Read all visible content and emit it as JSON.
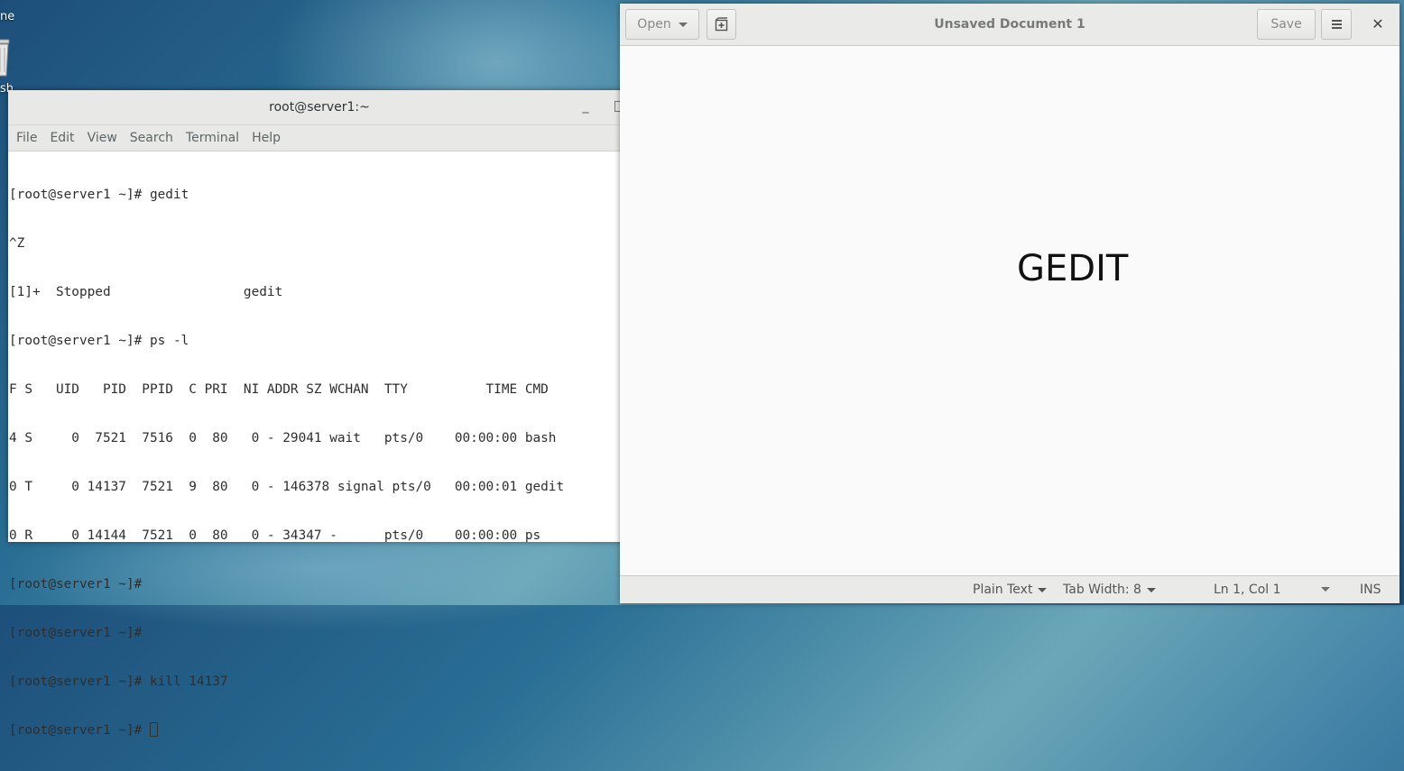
{
  "desktop": {
    "icon1_label": "ne",
    "icon2_label": "sh"
  },
  "terminal": {
    "title": "root@server1:~",
    "menu": [
      "File",
      "Edit",
      "View",
      "Search",
      "Terminal",
      "Help"
    ],
    "lines": [
      "[root@server1 ~]# gedit",
      "^Z",
      "[1]+  Stopped                 gedit",
      "[root@server1 ~]# ps -l",
      "F S   UID   PID  PPID  C PRI  NI ADDR SZ WCHAN  TTY          TIME CMD",
      "4 S     0  7521  7516  0  80   0 - 29041 wait   pts/0    00:00:00 bash",
      "0 T     0 14137  7521  9  80   0 - 146378 signal pts/0   00:00:01 gedit",
      "0 R     0 14144  7521  0  80   0 - 34347 -      pts/0    00:00:00 ps",
      "[root@server1 ~]#",
      "[root@server1 ~]#",
      "[root@server1 ~]# kill 14137"
    ],
    "prompt": "[root@server1 ~]# "
  },
  "gedit": {
    "title": "Unsaved Document 1",
    "open_label": "Open",
    "save_label": "Save",
    "content": "GEDIT",
    "status": {
      "language": "Plain Text",
      "tab_width": "Tab Width: 8",
      "position": "Ln 1, Col 1",
      "mode": "INS"
    }
  }
}
